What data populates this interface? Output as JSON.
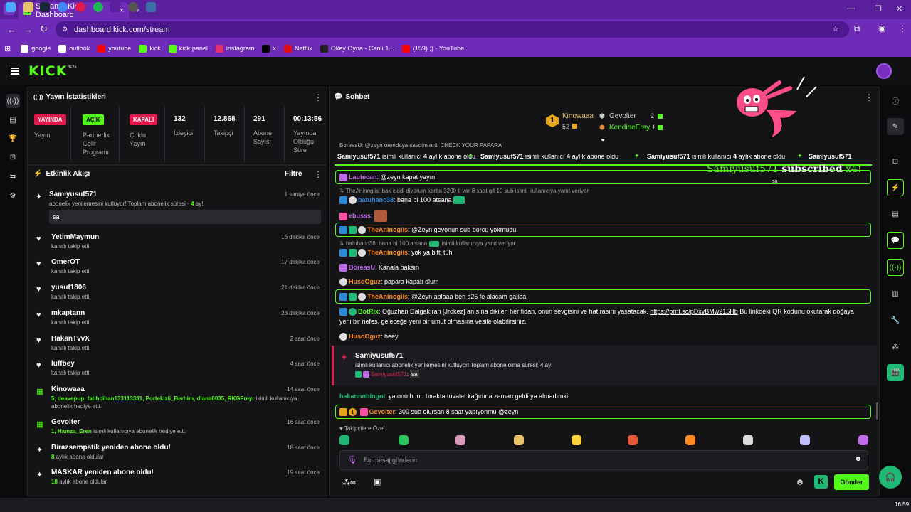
{
  "browser": {
    "tab_title": "Stream - Kick Dashboard",
    "tab_close": "×",
    "new_tab": "+",
    "url_domain": "dashboard.kick.com",
    "url_path": "/stream",
    "bookmarks": [
      {
        "label": "google",
        "icon": "google-icon",
        "color": "#ffffff"
      },
      {
        "label": "outlook",
        "icon": "outlook-icon",
        "color": "#ffffff"
      },
      {
        "label": "youtube",
        "icon": "youtube-icon",
        "color": "#ff0000"
      },
      {
        "label": "kick",
        "icon": "kick-icon",
        "color": "#53fc18"
      },
      {
        "label": "kick panel",
        "icon": "kick-icon",
        "color": "#53fc18"
      },
      {
        "label": "instagram",
        "icon": "instagram-icon",
        "color": "#e1306c"
      },
      {
        "label": "x",
        "icon": "x-icon",
        "color": "#000000"
      },
      {
        "label": "Netflix",
        "icon": "netflix-icon",
        "color": "#e50914"
      },
      {
        "label": "Okey Oyna - Canlı 1...",
        "icon": "okey-icon",
        "color": "#222222"
      },
      {
        "label": "(159) ;) - YouTube",
        "icon": "youtube-icon",
        "color": "#ff0000"
      }
    ]
  },
  "header": {
    "logo": "KICK",
    "beta": "BETA"
  },
  "stats": {
    "title": "Yayın İstatistikleri",
    "items": [
      {
        "badge": "YAYINDA",
        "label": "Yayın"
      },
      {
        "badge": "AÇIK",
        "label": "Partnerlik Gelir Programı"
      },
      {
        "badge": "KAPALI",
        "label": "Çoklu Yayın"
      },
      {
        "value": "132",
        "label": "İzleyici"
      },
      {
        "value": "12.868",
        "label": "Takipçi"
      },
      {
        "value": "291",
        "label": "Abone Sayısı"
      },
      {
        "value": "00:13:56",
        "label": "Yayında Olduğu Süre"
      }
    ]
  },
  "activity": {
    "title": "Etkinlik Akışı",
    "filter": "Filtre",
    "first": {
      "name": "Samiyusuf571",
      "time": "1 saniye önce",
      "text_a": "abonelik yenilemesini kutluyor! Toplam abonelik süresi - ",
      "text_num": "4",
      "text_b": " ay!",
      "message": "sa"
    },
    "follows": [
      {
        "name": "YetimMaymun",
        "sub": "kanalı takip etti",
        "time": "16 dakika önce"
      },
      {
        "name": "OmerOT",
        "sub": "kanalı takip etti",
        "time": "17 dakika önce"
      },
      {
        "name": "yusuf1806",
        "sub": "kanalı takip etti",
        "time": "21 dakika önce"
      },
      {
        "name": "mkaptann",
        "sub": "kanalı takip etti",
        "time": "23 dakika önce"
      },
      {
        "name": "HakanTvvX",
        "sub": "kanalı takip etti",
        "time": "2 saat önce"
      },
      {
        "name": "luffbey",
        "sub": "kanalı takip etti",
        "time": "4 saat önce"
      }
    ],
    "gift1": {
      "name": "Kinowaaa",
      "time": "14 saat önce",
      "g_line1": "5, deavepup, fatihcihan133113331, Portekizli_Berhim, diana0035, RKGFreyr",
      "line1_rest": " isimli kullanıcıya",
      "line2": "abonelik hediye etti."
    },
    "gift2": {
      "name": "Gevolter",
      "time": "16 saat önce",
      "g_line": "1, Hamza_Eren",
      "rest": " isimli kullanıcıya abonelik hediye etti."
    },
    "resubs": [
      {
        "name": "Birazsempatik yeniden abone oldu!",
        "num": "8",
        "sub": " aylık abone oldular",
        "time": "18 saat önce"
      },
      {
        "name": "MASKAR yeniden abone oldu!",
        "num": "18",
        "sub": " aylık abone oldular",
        "time": "19 saat önce"
      }
    ]
  },
  "chat": {
    "title": "Sohbet",
    "leaderboard": [
      {
        "rank": "1",
        "name": "Kinowaaa",
        "count": "52"
      },
      {
        "rank": "",
        "name": "Gevolter",
        "count": "2"
      },
      {
        "rank": "",
        "name": "KendineEray",
        "count": "1"
      }
    ],
    "overlay_name": "Samiyusuf571",
    "overlay_text": "subscribed",
    "overlay_count": "x4!",
    "overlay_msg": "sa",
    "pinned_top": "BoreasU: @zeyn orendaya savdim artti CHECK YOUR PAPARA",
    "ticker_name": "Samiyusuf571",
    "ticker_a": " isimli kullanıcı ",
    "ticker_num": "4",
    "ticker_b": " aylık abone oldu",
    "messages": [
      {
        "user": "Lautecan",
        "color": "#c06ae8",
        "text": ": @zeyn kapat yayını"
      },
      {
        "reply": "TheAninogiis: bak ciddi diyorum kartta 3200 tl var 8 saat git 10 sub isimli kullanıcıya yanıt veriyor"
      },
      {
        "user": "batuhanc38",
        "color": "#2a8ad8",
        "text": ": bana bi 100 atsana"
      },
      {
        "user": "ebusss",
        "color": "#c06ae8",
        "text": ":"
      },
      {
        "user": "TheAninogiis",
        "color": "#ff8a1f",
        "text": ": @Zeyn gevonun sub borcu yokmudu"
      },
      {
        "reply": "batuhanc38: bana bi 100 atsana",
        "reply_rest": " isimli kullanıcıya yanıt veriyor"
      },
      {
        "user": "TheAninogiis",
        "color": "#ff8a1f",
        "text": ": yok ya bitti tüh"
      },
      {
        "user": "BoreasU",
        "color": "#c06ae8",
        "text": ": Kanala baksın"
      },
      {
        "user": "HusoOguz",
        "color": "#ff8a1f",
        "text": ": papara kapalı olum"
      },
      {
        "user": "TheAninogiis",
        "color": "#ff8a1f",
        "text": ": @Zeyn ablaaa ben s25 fe alacam galiba"
      },
      {
        "user": "BotRix",
        "color": "#53fc18",
        "text": ": Oğuzhan Dalgakıran [Jrokez] anısına dikilen her fidan, onun sevgisini ve hatırasını yaşatacak. ",
        "link": "https://prnt.sc/pDxvBMw215Hb",
        "text2": " Bu linkdeki QR kodunu okutarak doğaya",
        "text3": "yeni bir nefes, geleceğe yeni bir umut olmasına vesile olabilirsiniz."
      },
      {
        "user": "HusoOguz",
        "color": "#ff8a1f",
        "text": ": heey"
      }
    ],
    "sub_event": {
      "name": "Samiyusuf571",
      "text": "isimli kullanıcı abonelik yenilemesini kutluyor! Toplam abone olma süresi: 4 ay!",
      "msg_user": "Samiyusuf571",
      "msg": "sa"
    },
    "msg_hakan": {
      "user": "hakannnbingol",
      "color": "#1fb874",
      "text": ": ya onu bunu bırakta tuvalet kağıdına zaman geldi ya almadımki"
    },
    "msg_gevolter": {
      "badge": "1",
      "user": "Gevolter",
      "color": "#ff8a1f",
      "text": ": 300 sub olursan 8 saat yapıyonmu @zeyn"
    },
    "emote_header": "Takipçilere Özel",
    "input_placeholder": "Bir mesaj gönderin",
    "send": "Gönder"
  },
  "taskbar": {
    "clock": "16:59"
  },
  "colors": {
    "kick_green": "#53fc18",
    "live_red": "#e21a4b",
    "chrome_purple": "#6d2bb8"
  }
}
